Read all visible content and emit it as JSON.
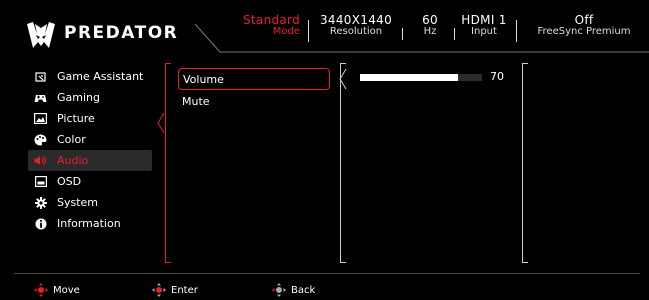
{
  "header": {
    "brand": "PREDATOR",
    "status": [
      {
        "value": "Standard",
        "label": "Mode",
        "accent": true
      },
      {
        "value": "3440X1440",
        "label": "Resolution",
        "accent": false
      },
      {
        "value": "60",
        "label": "Hz",
        "accent": false
      },
      {
        "value": "HDMI 1",
        "label": "Input",
        "accent": false
      },
      {
        "value": "Off",
        "label": "FreeSync Premium",
        "accent": false
      }
    ]
  },
  "menu": {
    "items": [
      {
        "label": "Game Assistant",
        "icon": "game-assistant-icon",
        "active": false
      },
      {
        "label": "Gaming",
        "icon": "gamepad-icon",
        "active": false
      },
      {
        "label": "Picture",
        "icon": "picture-icon",
        "active": false
      },
      {
        "label": "Color",
        "icon": "palette-icon",
        "active": false
      },
      {
        "label": "Audio",
        "icon": "speaker-icon",
        "active": true
      },
      {
        "label": "OSD",
        "icon": "osd-icon",
        "active": false
      },
      {
        "label": "System",
        "icon": "gear-icon",
        "active": false
      },
      {
        "label": "Information",
        "icon": "info-icon",
        "active": false
      }
    ]
  },
  "submenu": {
    "items": [
      {
        "label": "Volume",
        "selected": true
      },
      {
        "label": "Mute",
        "selected": false
      }
    ]
  },
  "volume": {
    "value": "70",
    "fraction": 0.8
  },
  "footer": {
    "move": "Move",
    "enter": "Enter",
    "back": "Back"
  },
  "colors": {
    "accent": "#e8202a",
    "background": "#000000",
    "text": "#ffffff"
  }
}
